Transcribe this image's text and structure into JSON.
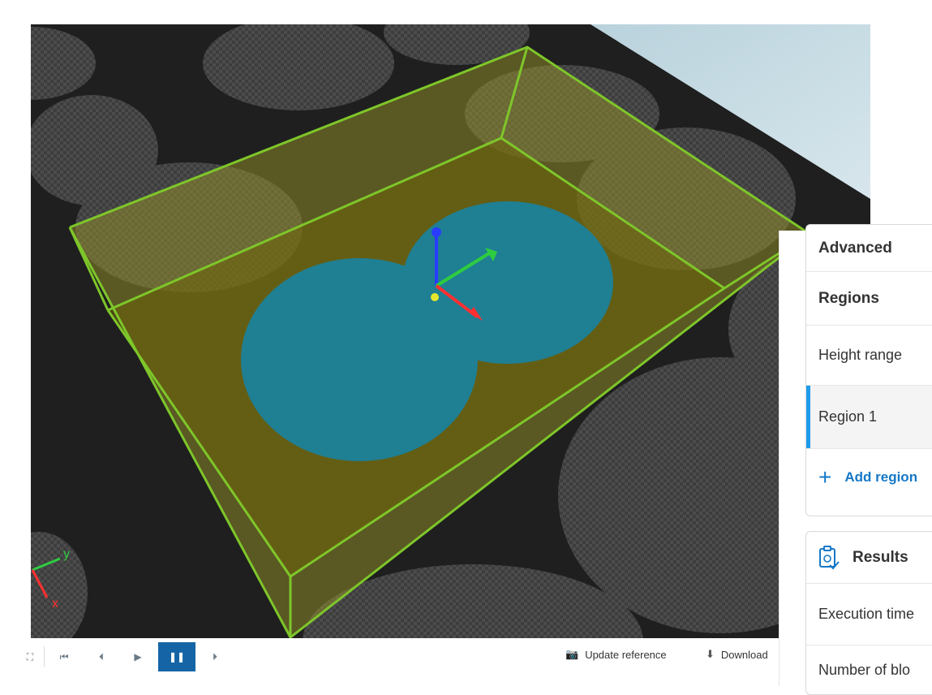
{
  "viewport": {
    "axes": {
      "y_label": "y",
      "x_label": "x"
    }
  },
  "toolbar": {
    "update_reference_label": "Update reference",
    "download_label": "Download"
  },
  "panel": {
    "advanced_label": "Advanced",
    "regions_label": "Regions",
    "height_range_label": "Height range",
    "region1_label": "Region 1",
    "add_region_label": "Add region",
    "results_label": "Results",
    "execution_time_label": "Execution time",
    "number_of_blobs_label": "Number of blo"
  },
  "colors": {
    "accent": "#1565a6",
    "link": "#1478c8",
    "selection_bar": "#1e9bea",
    "region_box": "#7ec62a",
    "blob_fill": "#1f7f93"
  }
}
